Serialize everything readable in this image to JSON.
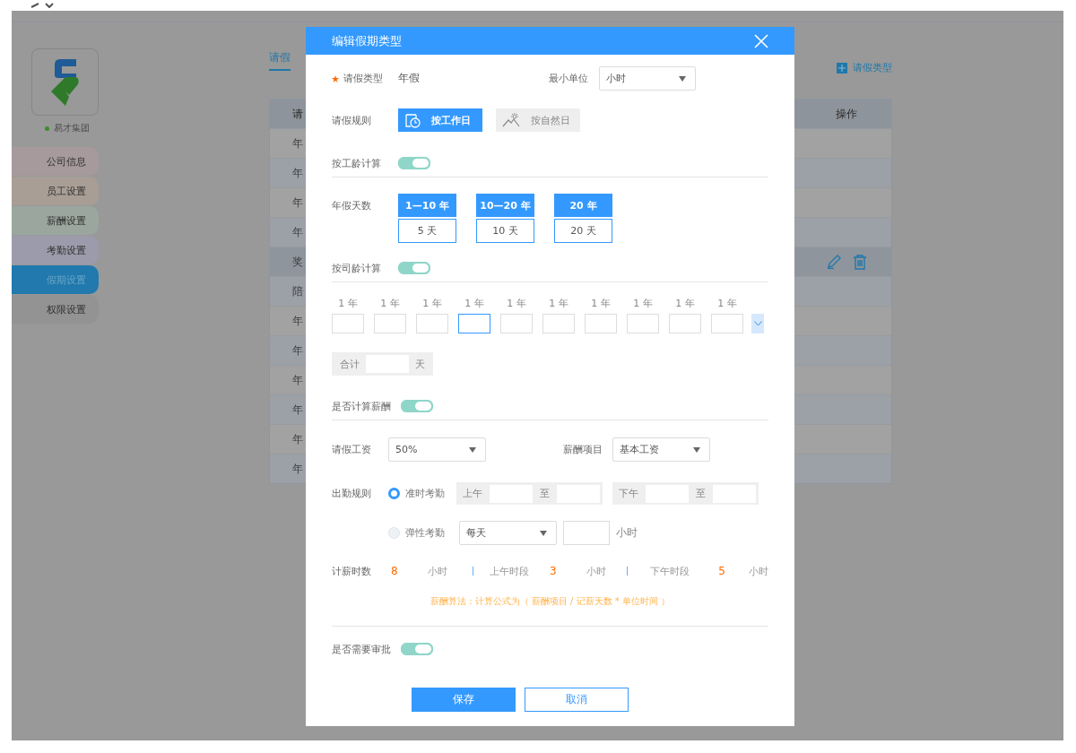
{
  "app": {
    "company": "易才集团",
    "menu": [
      {
        "label": "公司信息",
        "selected": false,
        "color": "#a69a9c"
      },
      {
        "label": "员工设置",
        "selected": false,
        "color": "#a89e95"
      },
      {
        "label": "薪酬设置",
        "selected": false,
        "color": "#9aa69e"
      },
      {
        "label": "考勤设置",
        "selected": false,
        "color": "#9c9bab"
      },
      {
        "label": "假期设置",
        "selected": true,
        "color": "#2179ad"
      },
      {
        "label": "权限设置",
        "selected": false,
        "color": "#939393"
      }
    ],
    "tab": {
      "label": "请假",
      "selected": true
    },
    "add_button": "请假类型",
    "table": {
      "columns": [
        "请",
        "操作"
      ],
      "rows": [
        {
          "cells": [
            "年"
          ],
          "selected": false
        },
        {
          "cells": [
            "年"
          ],
          "selected": false
        },
        {
          "cells": [
            "年"
          ],
          "selected": false
        },
        {
          "cells": [
            "年"
          ],
          "selected": false
        },
        {
          "cells": [
            "奖"
          ],
          "selected": true
        },
        {
          "cells": [
            "陪"
          ],
          "selected": false
        },
        {
          "cells": [
            "年"
          ],
          "selected": false
        },
        {
          "cells": [
            "年"
          ],
          "selected": false
        },
        {
          "cells": [
            "年"
          ],
          "selected": false
        },
        {
          "cells": [
            "年"
          ],
          "selected": false
        },
        {
          "cells": [
            "年"
          ],
          "selected": false
        },
        {
          "cells": [
            "年"
          ],
          "selected": false
        }
      ]
    }
  },
  "dialog": {
    "title": "编辑假期类型",
    "leave_type": {
      "label": "请假类型",
      "required": true,
      "value": "年假"
    },
    "min_unit": {
      "label": "最小单位",
      "value": "小时"
    },
    "rule": {
      "label": "请假规则",
      "options": [
        {
          "label": "按工作日",
          "selected": true,
          "kind": "workday"
        },
        {
          "label": "按自然日",
          "selected": false,
          "kind": "natural"
        }
      ]
    },
    "by_seniority": {
      "label": "按工龄计算",
      "on": true
    },
    "annual_days": {
      "label": "年假天数",
      "tiers": [
        {
          "range": "1—10 年",
          "days": "5 天"
        },
        {
          "range": "10—20 年",
          "days": "10 天"
        },
        {
          "range": "20 年",
          "days": "20 天"
        }
      ]
    },
    "by_company_seniority": {
      "label": "按司龄计算",
      "on": true
    },
    "year_inputs": [
      {
        "label": "1 年",
        "focused": false
      },
      {
        "label": "1 年",
        "focused": false
      },
      {
        "label": "1 年",
        "focused": false
      },
      {
        "label": "1 年",
        "focused": true
      },
      {
        "label": "1 年",
        "focused": false
      },
      {
        "label": "1 年",
        "focused": false
      },
      {
        "label": "1 年",
        "focused": false
      },
      {
        "label": "1 年",
        "focused": false
      },
      {
        "label": "1 年",
        "focused": false
      },
      {
        "label": "1 年",
        "focused": false
      }
    ],
    "total": {
      "label": "合计",
      "unit": "天"
    },
    "calc_pay": {
      "label": "是否计算薪酬",
      "on": true
    },
    "leave_wage": {
      "label": "请假工资",
      "value": "50%"
    },
    "pay_item": {
      "label": "薪酬项目",
      "value": "基本工资"
    },
    "attendance": {
      "label": "出勤规则",
      "options": [
        {
          "label": "准时考勤",
          "selected": true,
          "kind": "range",
          "groups": [
            {
              "label": "上午",
              "to": "至"
            },
            {
              "label": "下午",
              "to": "至"
            }
          ]
        },
        {
          "label": "弹性考勤",
          "selected": false,
          "kind": "flex",
          "period": "每天",
          "unit": "小时"
        }
      ]
    },
    "paid_hours": {
      "label": "计薪时数",
      "items": [
        {
          "value": "8",
          "unit": "小时"
        },
        {
          "label": "上午时段",
          "value": "3",
          "unit": "小时"
        },
        {
          "label": "下午时段",
          "value": "5",
          "unit": "小时"
        }
      ]
    },
    "formula": "薪酬算法：计算公式为（ 薪酬项目 / 记薪天数 * 单位时间 ）",
    "approval": {
      "label": "是否需要审批",
      "on": true
    },
    "buttons": [
      {
        "label": "保存",
        "kind": "primary"
      },
      {
        "label": "取消",
        "kind": "secondary"
      }
    ]
  }
}
